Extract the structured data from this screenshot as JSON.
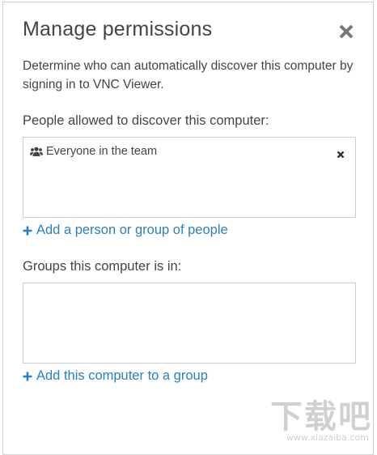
{
  "dialog": {
    "title": "Manage permissions",
    "close_icon": "close-icon",
    "description": "Determine who can automatically discover this computer by signing in to VNC Viewer."
  },
  "people_section": {
    "label": "People allowed to discover this computer:",
    "entries": [
      {
        "icon": "people-icon",
        "label": "Everyone in the team",
        "remove_icon": "remove-icon"
      }
    ],
    "add_link": "Add a person or group of people"
  },
  "groups_section": {
    "label": "Groups this computer is in:",
    "entries": [],
    "add_link": "Add this computer to a group"
  },
  "watermark": {
    "main": "下载吧",
    "sub": "www.xiazaiba.com"
  },
  "colors": {
    "text": "#444444",
    "link": "#2a7fc0",
    "border": "#cccccc",
    "close": "#666666"
  }
}
